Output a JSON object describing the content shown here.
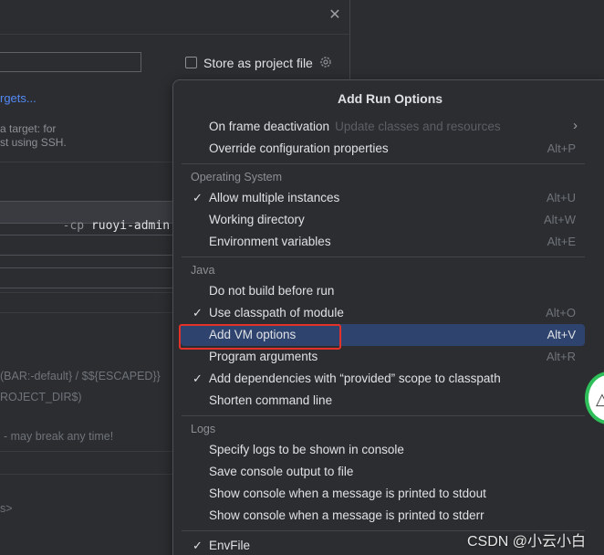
{
  "dialog": {
    "store_label": "Store as project file",
    "targets_link": "rgets...",
    "hint_line1": "a target: for",
    "hint_line2": "st using SSH.",
    "cmd_flag": "-cp ",
    "cmd_value": "ruoyi-admin",
    "env_line1": "(BAR:-default} / $${ESCAPED}}",
    "env_line2": "ROJECT_DIR$)",
    "warning": "- may break any time!",
    "bottom_text": "s>"
  },
  "popup": {
    "title": "Add Run Options",
    "frame_deactivation": {
      "label": "On frame deactivation",
      "hint": "Update classes and resources"
    },
    "override_config": {
      "label": "Override configuration properties",
      "shortcut": "Alt+P"
    },
    "os_section": "Operating System",
    "allow_multiple": {
      "label": "Allow multiple instances",
      "shortcut": "Alt+U",
      "checked": true
    },
    "working_dir": {
      "label": "Working directory",
      "shortcut": "Alt+W"
    },
    "env_vars": {
      "label": "Environment variables",
      "shortcut": "Alt+E"
    },
    "java_section": "Java",
    "no_build": {
      "label": "Do not build before run"
    },
    "use_classpath": {
      "label": "Use classpath of module",
      "shortcut": "Alt+O",
      "checked": true
    },
    "add_vm": {
      "label": "Add VM options",
      "shortcut": "Alt+V"
    },
    "program_args": {
      "label": "Program arguments",
      "shortcut": "Alt+R"
    },
    "add_deps": {
      "label": "Add dependencies with “provided” scope to classpath",
      "checked": true
    },
    "shorten_cmd": {
      "label": "Shorten command line"
    },
    "logs_section": "Logs",
    "specify_logs": {
      "label": "Specify logs to be shown in console"
    },
    "save_console": {
      "label": "Save console output to file"
    },
    "show_stdout": {
      "label": "Show console when a message is printed to stdout"
    },
    "show_stderr": {
      "label": "Show console when a message is printed to stderr"
    },
    "envfile": {
      "label": "EnvFile",
      "checked": true
    }
  },
  "icons": {
    "check": "checkmark-icon",
    "chevron": "chevron-right-icon",
    "close": "close-icon",
    "gear": "gear-icon"
  },
  "colors": {
    "selection": "#2e436e",
    "highlight_box": "#e4312a",
    "link": "#548af7"
  },
  "watermark": "CSDN @小云小白"
}
